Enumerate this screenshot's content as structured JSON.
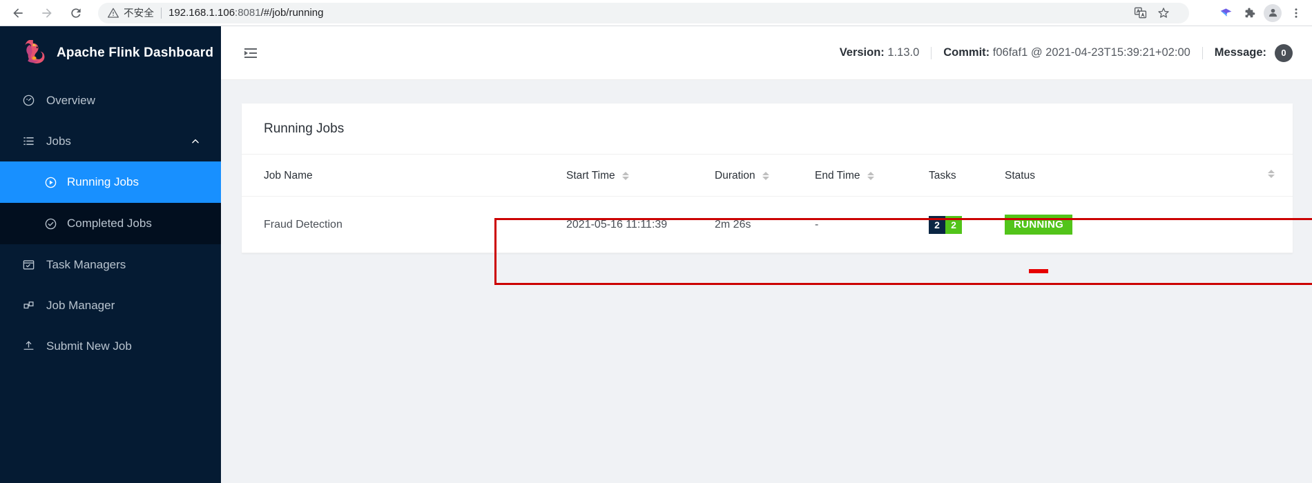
{
  "browser": {
    "back_icon": "back-arrow-icon",
    "forward_icon": "forward-arrow-icon",
    "reload_icon": "reload-icon",
    "security_warning_icon": "warning-triangle-icon",
    "security_label": "不安全",
    "url_host": "192.168.1.106",
    "url_port": ":8081",
    "url_path": "/#/job/running",
    "toolbar_icons": [
      "translate-icon",
      "bookmark-star-icon",
      "extension-bird-icon",
      "extensions-puzzle-icon",
      "profile-avatar-icon",
      "chrome-menu-icon"
    ]
  },
  "sidebar": {
    "brand": "Apache Flink Dashboard",
    "logo_icon": "flink-squirrel-logo",
    "items": [
      {
        "label": "Overview",
        "icon": "dashboard-icon",
        "active": false
      },
      {
        "label": "Jobs",
        "icon": "list-icon",
        "active": false,
        "expanded": true,
        "caret_icon": "chevron-up-icon"
      },
      {
        "label": "Running Jobs",
        "icon": "play-circle-icon",
        "active": true
      },
      {
        "label": "Completed Jobs",
        "icon": "check-circle-icon",
        "active": false
      },
      {
        "label": "Task Managers",
        "icon": "task-manager-icon",
        "active": false
      },
      {
        "label": "Job Manager",
        "icon": "job-manager-icon",
        "active": false
      },
      {
        "label": "Submit New Job",
        "icon": "upload-icon",
        "active": false
      }
    ]
  },
  "topbar": {
    "fold_icon": "menu-fold-icon",
    "version_label": "Version:",
    "version_value": "1.13.0",
    "commit_label": "Commit:",
    "commit_value": "f06faf1 @ 2021-04-23T15:39:21+02:00",
    "message_label": "Message:",
    "message_count": "0"
  },
  "main": {
    "card_title": "Running Jobs",
    "columns": [
      {
        "label": "Job Name",
        "sortable": false
      },
      {
        "label": "Start Time",
        "sortable": true
      },
      {
        "label": "Duration",
        "sortable": true
      },
      {
        "label": "End Time",
        "sortable": true
      },
      {
        "label": "Tasks",
        "sortable": false
      },
      {
        "label": "Status",
        "sortable": true
      }
    ],
    "rows": [
      {
        "job_name": "Fraud Detection",
        "start_time": "2021-05-16 11:11:39",
        "duration": "2m 26s",
        "end_time": "-",
        "tasks_total": "2",
        "tasks_running": "2",
        "status": "RUNNING"
      }
    ]
  },
  "colors": {
    "sidebar_bg": "#051b33",
    "sidebar_active": "#1890ff",
    "status_running": "#52c41a",
    "task_total_bg": "#0b2644",
    "annotation_red": "#cc0000"
  }
}
